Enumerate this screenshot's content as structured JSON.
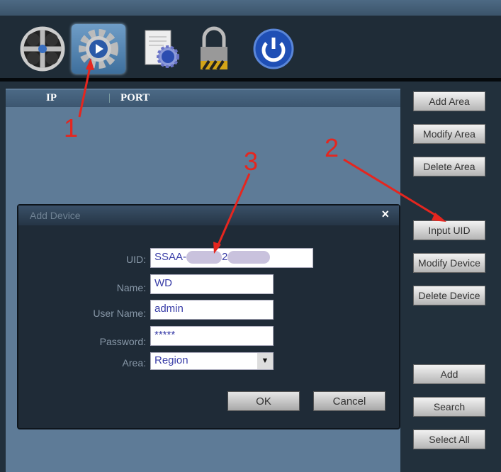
{
  "toolbar": {
    "icons": [
      "camera-reel-icon",
      "settings-play-icon",
      "document-gear-icon",
      "lock-icon",
      "power-icon"
    ],
    "active": 1
  },
  "list": {
    "columns": [
      "IP",
      "PORT"
    ]
  },
  "side_buttons": {
    "add_area": "Add Area",
    "modify_area": "Modify Area",
    "delete_area": "Delete Area",
    "input_uid": "Input UID",
    "modify_device": "Modify Device",
    "delete_device": "Delete Device",
    "add": "Add",
    "search": "Search",
    "select_all": "Select All"
  },
  "dialog": {
    "title": "Add Device",
    "close": "×",
    "uid_label": "UID:",
    "uid_value_prefix": "SSAA-",
    "uid_value_mid": "2",
    "name_label": "Name:",
    "name_value": "WD",
    "username_label": "User Name:",
    "username_value": "admin",
    "password_label": "Password:",
    "password_value": "*****",
    "area_label": "Area:",
    "area_value": "Region",
    "area_arrow": "▼",
    "ok": "OK",
    "cancel": "Cancel"
  },
  "annotations": {
    "step1": "1",
    "step2": "2",
    "step3": "3"
  },
  "colors": {
    "annotation": "#e5261f",
    "panel": "#5e7b97",
    "dialog": "#1f2b37"
  }
}
